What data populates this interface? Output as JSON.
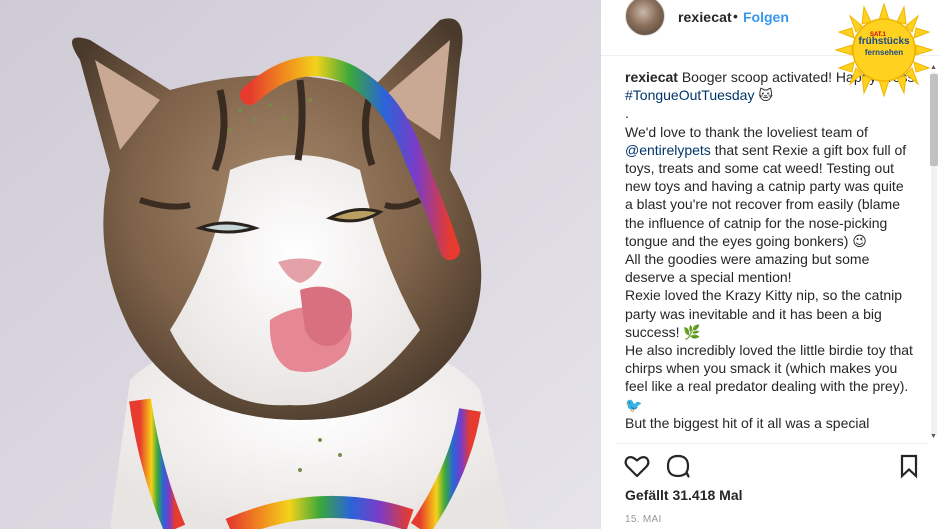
{
  "post": {
    "username": "rexiecat",
    "separator": "•",
    "follow_label": "Folgen"
  },
  "caption": {
    "user": "rexiecat",
    "line1": " Booger scoop activated! Happy gross ",
    "hashtag": "#TongueOutTuesday",
    "emoji1": " 🐱",
    "dot_line": ".",
    "para1_a": "We'd love to thank the loveliest team of ",
    "mention": "@entirelypets",
    "para1_b": " that sent Rexie a gift box full of toys, treats and some cat weed! Testing out new toys and having a catnip party was quite a blast you're not recover from easily (blame the influence of catnip for the nose-picking tongue and the eyes going bonkers) 😉",
    "para2": "All the goodies were amazing but some deserve a special mention!",
    "para3": "Rexie loved the Krazy Kitty nip, so the catnip party was inevitable and it has been a big success! 🌿",
    "para4": "He also incredibly loved the little birdie toy that chirps when you smack it (which makes you feel like a real predator dealing with the prey). 🐦",
    "para5": "But the biggest hit of it all was a special"
  },
  "stats": {
    "likes_prefix": "Gefällt ",
    "likes_count": "31.418",
    "likes_suffix": " Mal",
    "date": "15. MAI"
  },
  "icons": {
    "like": "heart-icon",
    "comment": "comment-icon",
    "save": "bookmark-icon",
    "scroll_up": "arrow-up-icon",
    "scroll_down": "arrow-down-icon"
  },
  "logo": {
    "brand": "SAT.1",
    "line1": "frühstücks",
    "line2": "fernsehen"
  },
  "colors": {
    "follow_blue": "#3897f0",
    "link_blue": "#003569",
    "text": "#262626",
    "sun_yellow": "#ffd21f"
  }
}
